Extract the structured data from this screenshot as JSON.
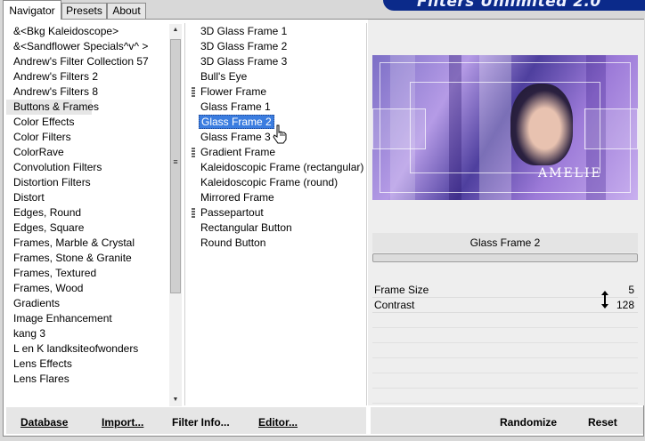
{
  "tabs": [
    {
      "label": "Navigator"
    },
    {
      "label": "Presets"
    },
    {
      "label": "About"
    }
  ],
  "banner": {
    "text": "Filters Unlimited 2.0"
  },
  "categories": [
    {
      "label": "&<Bkg Kaleidoscope>"
    },
    {
      "label": "&<Sandflower Specials^v^ >"
    },
    {
      "label": "Andrew's Filter Collection 57"
    },
    {
      "label": "Andrew's Filters 2"
    },
    {
      "label": "Andrew's Filters 8"
    },
    {
      "label": "Buttons & Frames"
    },
    {
      "label": "Color Effects"
    },
    {
      "label": "Color Filters"
    },
    {
      "label": "ColorRave"
    },
    {
      "label": "Convolution Filters"
    },
    {
      "label": "Distortion Filters"
    },
    {
      "label": "Distort"
    },
    {
      "label": "Edges, Round"
    },
    {
      "label": "Edges, Square"
    },
    {
      "label": "Frames, Marble & Crystal"
    },
    {
      "label": "Frames, Stone & Granite"
    },
    {
      "label": "Frames, Textured"
    },
    {
      "label": "Frames, Wood"
    },
    {
      "label": "Gradients"
    },
    {
      "label": "Image Enhancement"
    },
    {
      "label": "kang 3"
    },
    {
      "label": "L en K landksiteofwonders"
    },
    {
      "label": "Lens Effects"
    },
    {
      "label": "Lens Flares"
    }
  ],
  "selected_category": "Buttons & Frames",
  "filters": [
    {
      "label": "3D Glass Frame 1",
      "marker": false
    },
    {
      "label": "3D Glass Frame 2",
      "marker": false
    },
    {
      "label": "3D Glass Frame 3",
      "marker": false
    },
    {
      "label": "Bull's Eye",
      "marker": false
    },
    {
      "label": "Flower Frame",
      "marker": true
    },
    {
      "label": "Glass Frame 1",
      "marker": false
    },
    {
      "label": "Glass Frame 2",
      "marker": false
    },
    {
      "label": "Glass Frame 3",
      "marker": false
    },
    {
      "label": "Gradient Frame",
      "marker": true
    },
    {
      "label": "Kaleidoscopic Frame (rectangular)",
      "marker": false
    },
    {
      "label": "Kaleidoscopic Frame (round)",
      "marker": false
    },
    {
      "label": "Mirrored Frame",
      "marker": false
    },
    {
      "label": "Passepartout",
      "marker": true
    },
    {
      "label": "Rectangular Button",
      "marker": false
    },
    {
      "label": "Round Button",
      "marker": false
    }
  ],
  "selected_filter": "Glass Frame 2",
  "preview": {
    "caption": "AMELIE"
  },
  "filter_title": "Glass Frame 2",
  "params": [
    {
      "name": "Frame Size",
      "value": "5"
    },
    {
      "name": "Contrast",
      "value": "128"
    }
  ],
  "buttons": {
    "database": "Database",
    "import": "Import...",
    "filter_info": "Filter Info...",
    "editor": "Editor...",
    "randomize": "Randomize",
    "reset": "Reset"
  },
  "colors": {
    "selection": "#3b7de0",
    "banner": "#0b2a8a"
  }
}
